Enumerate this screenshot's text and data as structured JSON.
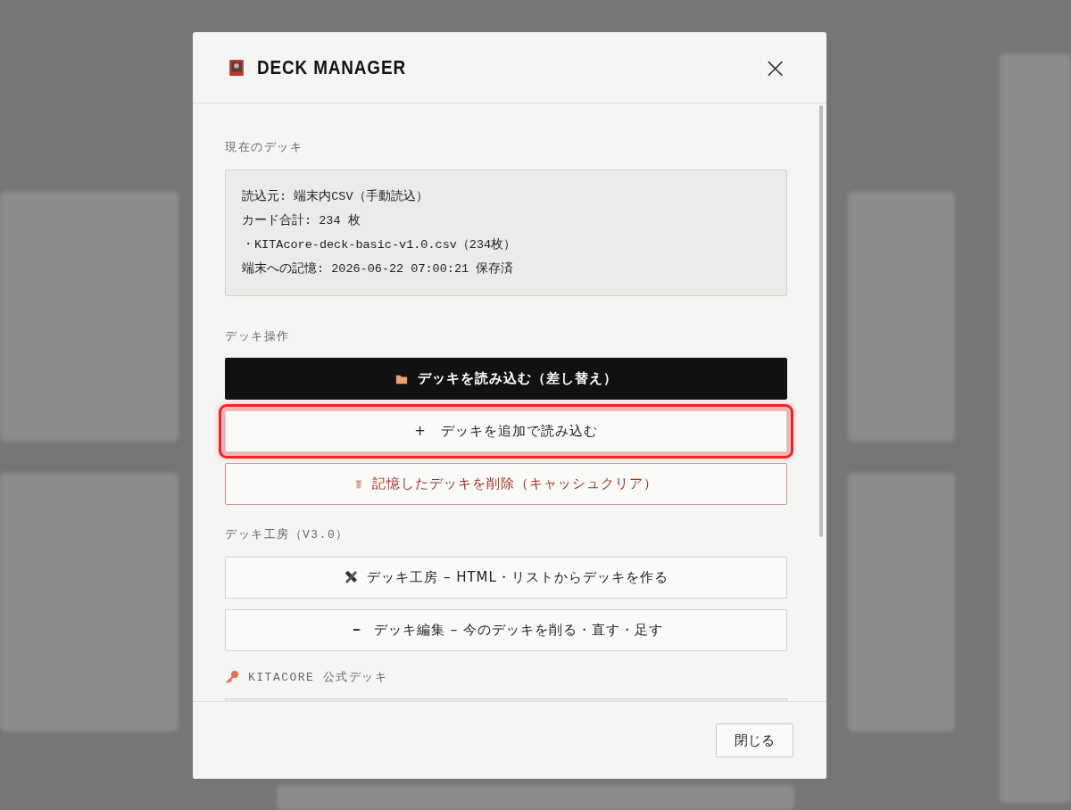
{
  "dialog": {
    "title": "DECK MANAGER",
    "close_label": "×"
  },
  "current_deck": {
    "label": "現在のデッキ",
    "lines": [
      "読込元: 端末内CSV（手動読込）",
      "カード合計: 234 枚",
      "・KITAcore-deck-basic-v1.0.csv（234枚）",
      "端末への記憶: 2026-06-22 07:00:21 保存済"
    ]
  },
  "sections": [
    {
      "label": "デッキ操作",
      "buttons": [
        {
          "kind": "load",
          "label": "デッキを読み込む（差し替え）",
          "highlighted": false
        },
        {
          "kind": "add",
          "label": "+　デッキを追加で読み込む",
          "highlighted": true
        },
        {
          "kind": "delete",
          "label": "記憶したデッキを削除（キャッシュクリア）",
          "highlighted": false
        }
      ]
    },
    {
      "label": "デッキ工房（V3.0）",
      "buttons": [
        {
          "kind": "workshop",
          "label": "デッキ工房 – HTML・リストからデッキを作る",
          "highlighted": false
        },
        {
          "kind": "edit",
          "label": "デッキ編集 – 今のデッキを削る・直す・足す",
          "highlighted": false
        }
      ]
    },
    {
      "label": "KITACORE 公式デッキ",
      "kind": "official"
    }
  ],
  "footer": {
    "close_button": "閉じる"
  }
}
